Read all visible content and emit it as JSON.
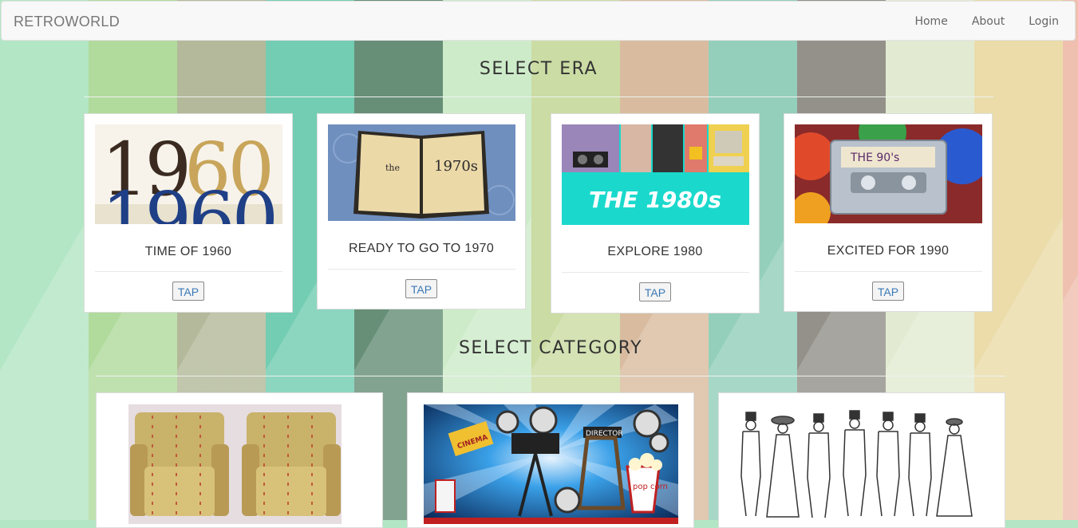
{
  "navbar": {
    "brand": "RETROWORLD",
    "links": [
      "Home",
      "About",
      "Login"
    ]
  },
  "sections": {
    "era_title": "SELECT ERA",
    "category_title": "SELECT CATEGORY"
  },
  "eras": [
    {
      "caption": "TIME OF 1960",
      "button": "TAP",
      "image_text": "1960"
    },
    {
      "caption": "READY TO GO TO 1970",
      "button": "TAP",
      "image_text_small": "the",
      "image_text": "1970s"
    },
    {
      "caption": "EXPLORE 1980",
      "button": "TAP",
      "image_text": "THE 1980s"
    },
    {
      "caption": "EXCITED FOR 1990",
      "button": "TAP",
      "image_text": "THE 90's"
    }
  ],
  "categories": [
    {
      "name": "furniture-image",
      "icon": "armchair-icon"
    },
    {
      "name": "movies-image",
      "icon": "film-camera-icon",
      "image_text": [
        "CINEMA",
        "DIRECTOR",
        "pop corn"
      ]
    },
    {
      "name": "fashion-image",
      "icon": "people-sketch-icon"
    }
  ],
  "colors": {
    "stripes": [
      "#b3e6c4",
      "#b1db9d",
      "#b3b99a",
      "#73cdb2",
      "#678f78",
      "#cdebc9",
      "#cbdca4",
      "#d4bc9f",
      "#94cfbb",
      "#94918a",
      "#e2ebd2",
      "#e6dca6",
      "#efc6b2"
    ]
  }
}
